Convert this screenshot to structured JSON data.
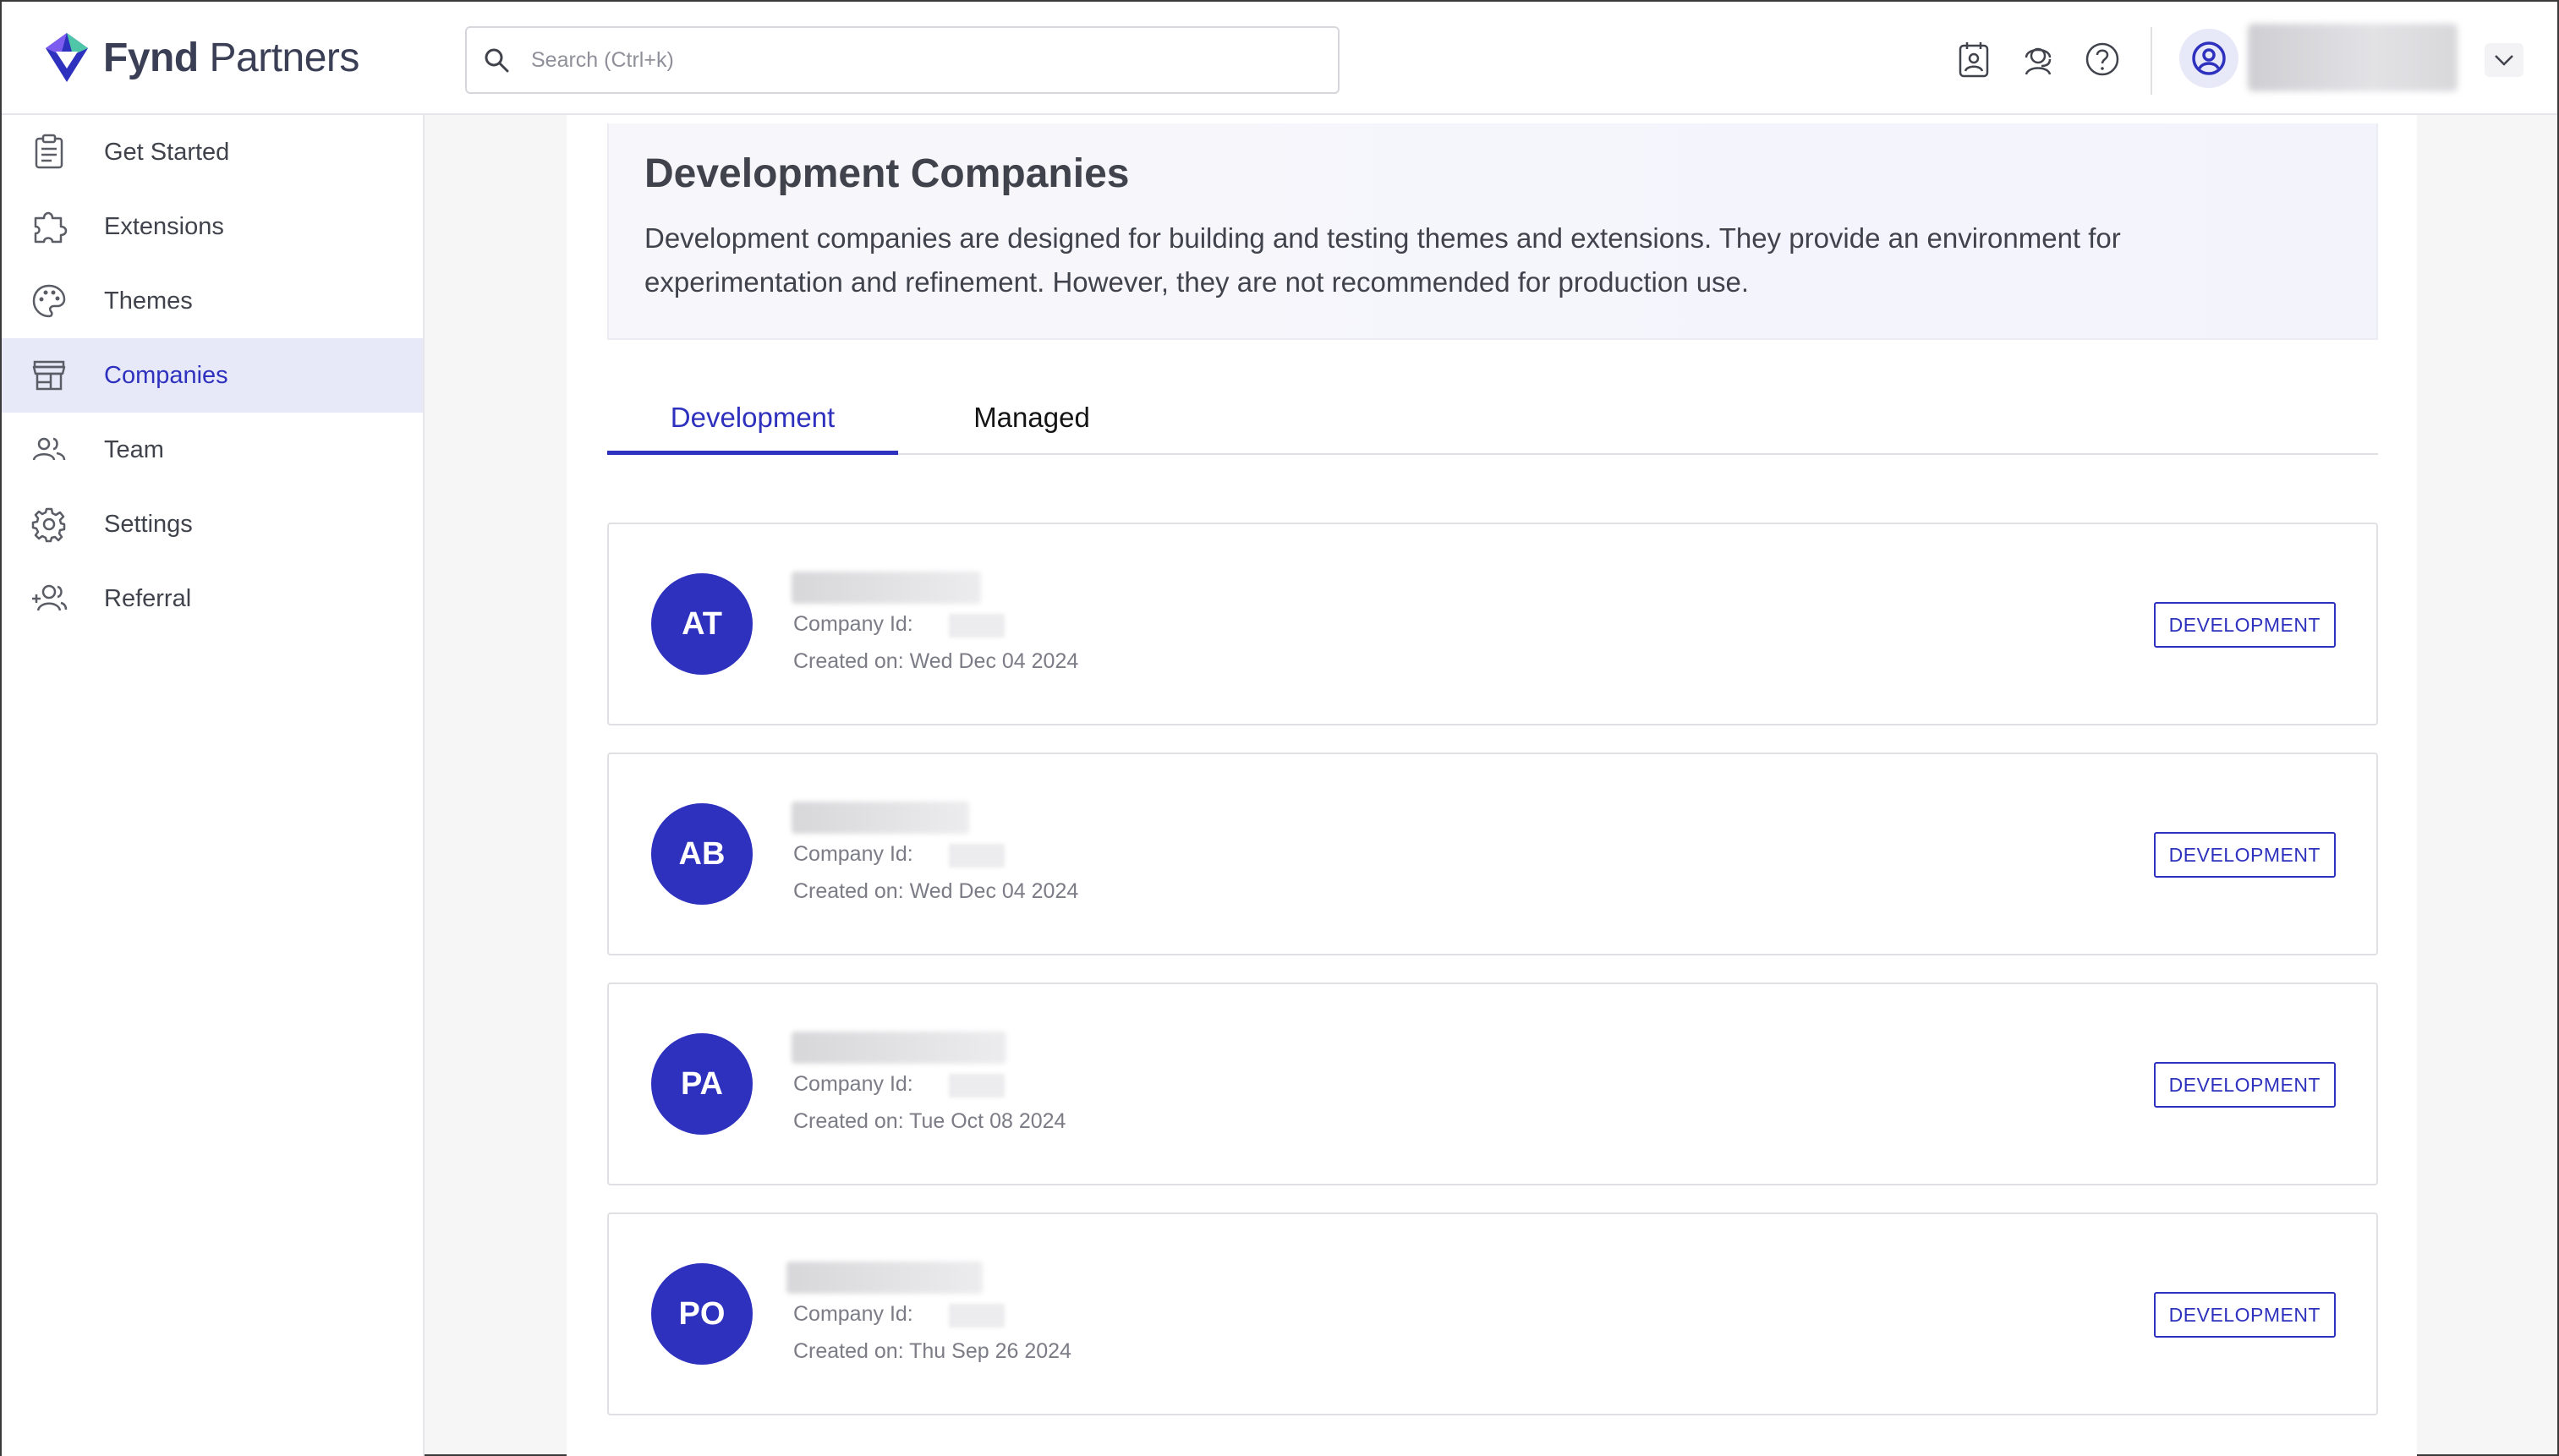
{
  "brand": {
    "name_bold": "Fynd",
    "name_rest": " Partners",
    "accent": "#2e31be"
  },
  "search": {
    "placeholder": "Search (Ctrl+k)",
    "value": ""
  },
  "header_icons": [
    "contact-card-icon",
    "support-agent-icon",
    "help-icon",
    "user-circle-icon",
    "chevron-down-icon"
  ],
  "sidebar": {
    "items": [
      {
        "label": "Get Started",
        "icon": "clipboard-icon"
      },
      {
        "label": "Extensions",
        "icon": "puzzle-icon"
      },
      {
        "label": "Themes",
        "icon": "palette-icon"
      },
      {
        "label": "Companies",
        "icon": "store-icon",
        "active": true
      },
      {
        "label": "Team",
        "icon": "team-icon"
      },
      {
        "label": "Settings",
        "icon": "gear-icon"
      },
      {
        "label": "Referral",
        "icon": "add-user-icon"
      }
    ]
  },
  "banner": {
    "title": "Development Companies",
    "description": "Development companies are designed for building and testing themes and extensions. They provide an environment for experimentation and refinement. However, they are not recommended for production use."
  },
  "tabs": [
    {
      "label": "Development",
      "active": true
    },
    {
      "label": "Managed",
      "active": false
    }
  ],
  "companies": [
    {
      "initials": "AT",
      "id_label": "Company Id:",
      "created": "Created on: Wed Dec 04 2024",
      "badge": "DEVELOPMENT"
    },
    {
      "initials": "AB",
      "id_label": "Company Id:",
      "created": "Created on: Wed Dec 04 2024",
      "badge": "DEVELOPMENT"
    },
    {
      "initials": "PA",
      "id_label": "Company Id:",
      "created": "Created on: Tue Oct 08 2024",
      "badge": "DEVELOPMENT"
    },
    {
      "initials": "PO",
      "id_label": "Company Id:",
      "created": "Created on: Thu Sep 26 2024",
      "badge": "DEVELOPMENT"
    }
  ]
}
